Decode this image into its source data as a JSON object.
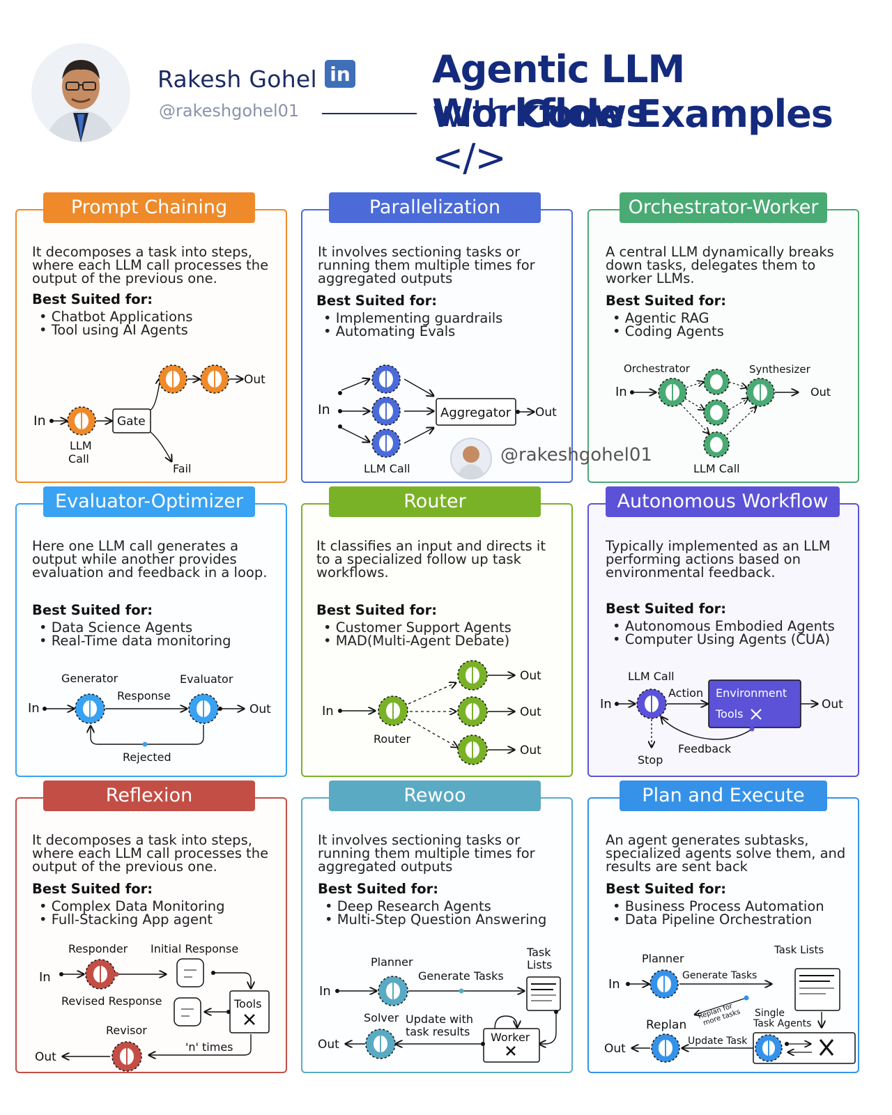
{
  "header": {
    "author_name": "Rakesh Gohel",
    "linkedin_label": "in",
    "handle": "@rakeshgohel01",
    "title_line1": "Agentic LLM Workflows",
    "title_line2_pre": "with",
    "title_line2_bold": "Code Examples",
    "title_line2_post": "</>"
  },
  "watermark": "@rakeshgohel01",
  "best_suited_label": "Best Suited for:",
  "cards": [
    {
      "title": "Prompt Chaining",
      "color": "#ee8a2a",
      "border": "#ee8a2a",
      "desc": "It decomposes a task into steps, where each LLM call processes the output of the previous one.",
      "bullets": [
        "Chatbot Applications",
        "Tool using AI Agents"
      ],
      "labels": {
        "in": "In",
        "gate": "Gate",
        "out": "Out",
        "llm_call": "LLM Call",
        "fail": "Fail"
      }
    },
    {
      "title": "Parallelization",
      "color": "#4b6bd9",
      "border": "#4b6bd9",
      "desc": "It involves sectioning tasks or running them multiple times for aggregated outputs",
      "bullets": [
        "Implementing guardrails",
        "Automating Evals"
      ],
      "labels": {
        "in": "In",
        "aggregator": "Aggregator",
        "out": "Out",
        "llm_call": "LLM Call"
      }
    },
    {
      "title": "Orchestrator-Worker",
      "color": "#4aaa74",
      "border": "#4aaa74",
      "desc": "A central LLM dynamically breaks down tasks, delegates them to worker LLMs.",
      "bullets": [
        "Agentic RAG",
        "Coding Agents"
      ],
      "labels": {
        "orchestrator": "Orchestrator",
        "synthesizer": "Synthesizer",
        "in": "In",
        "out": "Out",
        "llm_call": "LLM Call"
      }
    },
    {
      "title": "Evaluator-Optimizer",
      "color": "#39a2f2",
      "border": "#39a2f2",
      "desc": "Here one LLM call generates a output while another provides evaluation and feedback in a loop.",
      "bullets": [
        "Data Science Agents",
        "Real-Time data monitoring"
      ],
      "labels": {
        "generator": "Generator",
        "evaluator": "Evaluator",
        "response": "Response",
        "in": "In",
        "out": "Out",
        "rejected": "Rejected"
      }
    },
    {
      "title": "Router",
      "color": "#7ab227",
      "border": "#7ab227",
      "desc": "It classifies an input and directs it to a specialized follow up task workflows.",
      "bullets": [
        "Customer Support Agents",
        "MAD(Multi-Agent Debate)"
      ],
      "labels": {
        "in": "In",
        "router": "Router",
        "out": "Out"
      }
    },
    {
      "title": "Autonomous Workflow",
      "color": "#5b52d8",
      "border": "#5b52d8",
      "desc": "Typically implemented as an LLM performing actions based on environmental feedback.",
      "bullets": [
        "Autonomous Embodied Agents",
        "Computer Using Agents (CUA)"
      ],
      "labels": {
        "llm_call": "LLM Call",
        "action": "Action",
        "environment": "Environment",
        "tools": "Tools",
        "in": "In",
        "out": "Out",
        "stop": "Stop",
        "feedback": "Feedback"
      }
    },
    {
      "title": "Reflexion",
      "color": "#c34e45",
      "border": "#c34e45",
      "desc": "It decomposes a task into steps, where each LLM call processes the output of the previous one.",
      "bullets": [
        "Complex Data Monitoring",
        "Full-Stacking App agent"
      ],
      "labels": {
        "responder": "Responder",
        "initial_response": "Initial Response",
        "in": "In",
        "revised_response": "Revised Response",
        "tools": "Tools",
        "revisor": "Revisor",
        "n_times": "'n' times",
        "out": "Out"
      }
    },
    {
      "title": "Rewoo",
      "color": "#5aaac4",
      "border": "#5aaac4",
      "desc": "It involves sectioning tasks or running them multiple times for aggregated outputs",
      "bullets": [
        "Deep Research Agents",
        "Multi-Step Question Answering"
      ],
      "labels": {
        "planner": "Planner",
        "task_lists": "Task Lists",
        "generate_tasks": "Generate Tasks",
        "in": "In",
        "solver": "Solver",
        "update": "Update with task results",
        "worker": "Worker",
        "out": "Out"
      }
    },
    {
      "title": "Plan and Execute",
      "color": "#3592e8",
      "border": "#3592e8",
      "desc": "An agent generates subtasks, specialized agents solve them, and results are sent back",
      "bullets": [
        "Business Process Automation",
        "Data Pipeline Orchestration"
      ],
      "labels": {
        "planner": "Planner",
        "task_lists": "Task Lists",
        "generate_tasks": "Generate Tasks",
        "in": "In",
        "replan_more": "Replan for more tasks",
        "single_agents": "Single Task Agents",
        "replan": "Replan",
        "update_task": "Update Task",
        "out": "Out"
      }
    }
  ]
}
